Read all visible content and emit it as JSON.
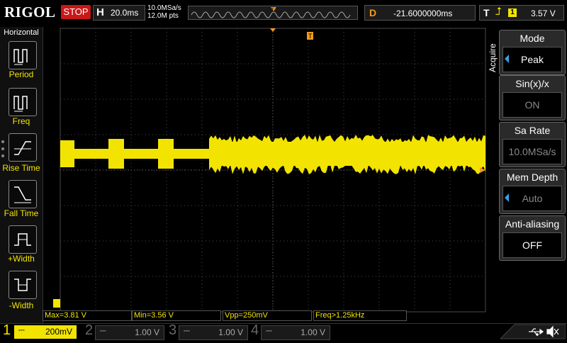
{
  "header": {
    "logo": "RIGOL",
    "run_state": "STOP",
    "timebase_label": "H",
    "timebase": "20.0ms",
    "sample_rate": "10.0MSa/s",
    "mem_points": "12.0M pts",
    "delay_label": "D",
    "delay": "-21.6000000ms",
    "trigger_label": "T",
    "trigger_channel": "1",
    "trigger_level": "3.57 V"
  },
  "left_panel": {
    "title": "Horizontal",
    "items": [
      {
        "label": "Period",
        "icon": "period-icon"
      },
      {
        "label": "Freq",
        "icon": "frequency-icon"
      },
      {
        "label": "Rise Time",
        "icon": "rise-time-icon"
      },
      {
        "label": "Fall Time",
        "icon": "fall-time-icon"
      },
      {
        "label": "+Width",
        "icon": "positive-width-icon"
      },
      {
        "label": "-Width",
        "icon": "negative-width-icon"
      }
    ]
  },
  "right_panel": {
    "section": "Acquire",
    "menus": [
      {
        "title": "Mode",
        "value": "Peak",
        "active": true
      },
      {
        "title": "Sin(x)/x",
        "value": "ON",
        "active": false
      },
      {
        "title": "Sa Rate",
        "value": "10.0MSa/s",
        "active": false
      },
      {
        "title": "Mem Depth",
        "value": "Auto",
        "active": false
      },
      {
        "title": "Anti-aliasing",
        "value": "OFF",
        "active": true
      }
    ]
  },
  "measurements": {
    "max": "Max=3.81 V",
    "min": "Min=3.56 V",
    "vpp": "Vpp=250mV",
    "freq": "Freq>1.25kHz"
  },
  "channels": [
    {
      "num": "1",
      "scale": "200mV",
      "active": true
    },
    {
      "num": "2",
      "scale": "1.00 V",
      "active": false
    },
    {
      "num": "3",
      "scale": "1.00 V",
      "active": false
    },
    {
      "num": "4",
      "scale": "1.00 V",
      "active": false
    }
  ],
  "colors": {
    "ch1": "#f2e400",
    "stop": "#c81818",
    "trigger": "#f39b1a",
    "grid": "#4a4a4a"
  }
}
